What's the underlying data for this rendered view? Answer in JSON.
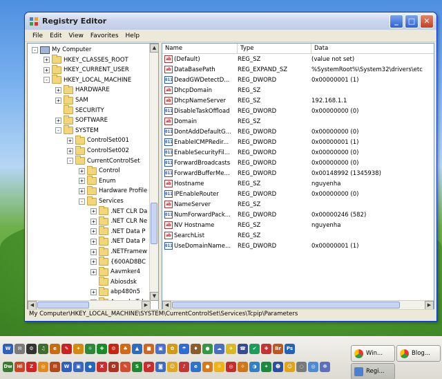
{
  "window": {
    "title": "Registry Editor",
    "buttons": {
      "minimize": "_",
      "maximize": "□",
      "close": "✕"
    }
  },
  "menu": [
    "File",
    "Edit",
    "View",
    "Favorites",
    "Help"
  ],
  "tree": [
    {
      "label": "My Computer",
      "depth": 0,
      "expander": "-",
      "icon": "computer"
    },
    {
      "label": "HKEY_CLASSES_ROOT",
      "depth": 1,
      "expander": "+",
      "icon": "folder"
    },
    {
      "label": "HKEY_CURRENT_USER",
      "depth": 1,
      "expander": "+",
      "icon": "folder"
    },
    {
      "label": "HKEY_LOCAL_MACHINE",
      "depth": 1,
      "expander": "-",
      "icon": "folder"
    },
    {
      "label": "HARDWARE",
      "depth": 2,
      "expander": "+",
      "icon": "folder"
    },
    {
      "label": "SAM",
      "depth": 2,
      "expander": "+",
      "icon": "folder"
    },
    {
      "label": "SECURITY",
      "depth": 2,
      "expander": "",
      "icon": "folder"
    },
    {
      "label": "SOFTWARE",
      "depth": 2,
      "expander": "+",
      "icon": "folder"
    },
    {
      "label": "SYSTEM",
      "depth": 2,
      "expander": "-",
      "icon": "folder"
    },
    {
      "label": "ControlSet001",
      "depth": 3,
      "expander": "+",
      "icon": "folder"
    },
    {
      "label": "ControlSet002",
      "depth": 3,
      "expander": "+",
      "icon": "folder"
    },
    {
      "label": "CurrentControlSet",
      "depth": 3,
      "expander": "-",
      "icon": "folder"
    },
    {
      "label": "Control",
      "depth": 4,
      "expander": "+",
      "icon": "folder"
    },
    {
      "label": "Enum",
      "depth": 4,
      "expander": "+",
      "icon": "folder"
    },
    {
      "label": "Hardware Profile",
      "depth": 4,
      "expander": "+",
      "icon": "folder"
    },
    {
      "label": "Services",
      "depth": 4,
      "expander": "-",
      "icon": "folder"
    },
    {
      "label": ".NET CLR Da",
      "depth": 5,
      "expander": "+",
      "icon": "folder"
    },
    {
      "label": ".NET CLR Ne",
      "depth": 5,
      "expander": "+",
      "icon": "folder"
    },
    {
      "label": ".NET Data P",
      "depth": 5,
      "expander": "+",
      "icon": "folder"
    },
    {
      "label": ".NET Data P",
      "depth": 5,
      "expander": "+",
      "icon": "folder"
    },
    {
      "label": ".NETFramew",
      "depth": 5,
      "expander": "+",
      "icon": "folder"
    },
    {
      "label": "{600AD8BC",
      "depth": 5,
      "expander": "+",
      "icon": "folder"
    },
    {
      "label": "Aavmker4",
      "depth": 5,
      "expander": "+",
      "icon": "folder"
    },
    {
      "label": "Abiosdsk",
      "depth": 5,
      "expander": "",
      "icon": "folder"
    },
    {
      "label": "abp480n5",
      "depth": 5,
      "expander": "+",
      "icon": "folder"
    },
    {
      "label": "Acapela Tele",
      "depth": 5,
      "expander": "+",
      "icon": "folder"
    }
  ],
  "list": {
    "headers": {
      "name": "Name",
      "type": "Type",
      "data": "Data"
    },
    "rows": [
      {
        "icon": "ab",
        "name": "(Default)",
        "type": "REG_SZ",
        "data": "(value not set)"
      },
      {
        "icon": "ab",
        "name": "DataBasePath",
        "type": "REG_EXPAND_SZ",
        "data": "%SystemRoot%\\System32\\drivers\\etc"
      },
      {
        "icon": "dword",
        "name": "DeadGWDetectD...",
        "type": "REG_DWORD",
        "data": "0x00000001 (1)"
      },
      {
        "icon": "ab",
        "name": "DhcpDomain",
        "type": "REG_SZ",
        "data": ""
      },
      {
        "icon": "ab",
        "name": "DhcpNameServer",
        "type": "REG_SZ",
        "data": "192.168.1.1"
      },
      {
        "icon": "dword",
        "name": "DisableTaskOffload",
        "type": "REG_DWORD",
        "data": "0x00000000 (0)"
      },
      {
        "icon": "ab",
        "name": "Domain",
        "type": "REG_SZ",
        "data": ""
      },
      {
        "icon": "dword",
        "name": "DontAddDefaultG...",
        "type": "REG_DWORD",
        "data": "0x00000000 (0)"
      },
      {
        "icon": "dword",
        "name": "EnableICMPRedir...",
        "type": "REG_DWORD",
        "data": "0x00000001 (1)"
      },
      {
        "icon": "dword",
        "name": "EnableSecurityFil...",
        "type": "REG_DWORD",
        "data": "0x00000000 (0)"
      },
      {
        "icon": "dword",
        "name": "ForwardBroadcasts",
        "type": "REG_DWORD",
        "data": "0x00000000 (0)"
      },
      {
        "icon": "dword",
        "name": "ForwardBufferMe...",
        "type": "REG_DWORD",
        "data": "0x00148992 (1345938)"
      },
      {
        "icon": "ab",
        "name": "Hostname",
        "type": "REG_SZ",
        "data": "nguyenha"
      },
      {
        "icon": "dword",
        "name": "IPEnableRouter",
        "type": "REG_DWORD",
        "data": "0x00000000 (0)"
      },
      {
        "icon": "ab",
        "name": "NameServer",
        "type": "REG_SZ",
        "data": ""
      },
      {
        "icon": "dword",
        "name": "NumForwardPack...",
        "type": "REG_DWORD",
        "data": "0x00000246 (582)"
      },
      {
        "icon": "ab",
        "name": "NV Hostname",
        "type": "REG_SZ",
        "data": "nguyenha"
      },
      {
        "icon": "ab",
        "name": "SearchList",
        "type": "REG_SZ",
        "data": ""
      },
      {
        "icon": "dword",
        "name": "UseDomainName...",
        "type": "REG_DWORD",
        "data": "0x00000001 (1)"
      }
    ]
  },
  "status": "My Computer\\HKEY_LOCAL_MACHINE\\SYSTEM\\CurrentControlSet\\Services\\Tcpip\\Parameters",
  "taskbar": {
    "buttons": [
      {
        "label": "Win...",
        "icon": "chrome"
      },
      {
        "label": "Blog...",
        "icon": "chrome"
      },
      {
        "label": "Regi...",
        "icon": "regedit",
        "active": true
      }
    ],
    "quicklaunch_top": [
      "W",
      "✉",
      "⚙",
      "♫",
      "e",
      "✎",
      "✦",
      "☼",
      "✚",
      "⚙",
      "♣",
      "▲",
      "■",
      "▣",
      "✿",
      "☂",
      "♦",
      "●",
      "☁",
      "✈",
      "☎",
      "✔",
      "✚",
      "Br",
      "Ps"
    ],
    "quicklaunch_bottom": [
      "Dw",
      "Hi",
      "Z",
      "◎",
      "✉",
      "W",
      "▣",
      "◆",
      "X",
      "O",
      "✎",
      "S",
      "P",
      "◙",
      "☺",
      "♪",
      "e",
      "●",
      "☼",
      "◎",
      "☼",
      "◑",
      "✦",
      "☻",
      "☺",
      "◌",
      "◎",
      "☸"
    ],
    "colors_top": [
      "#2f5fbf",
      "#7a7a7a",
      "#333",
      "#3b6f2e",
      "#c96c12",
      "#c22",
      "#d48a12",
      "#2a8a3a",
      "#1a8a2a",
      "#c21",
      "#d26914",
      "#2c6dc4",
      "#c62",
      "#4b70c9",
      "#cf9b17",
      "#2e6bd6",
      "#8a5c2d",
      "#2f9a3f",
      "#4c6fc2",
      "#d9b820",
      "#374d8f",
      "#1b9d5c",
      "#c23333",
      "#c0561e",
      "#2563b8"
    ],
    "colors_bottom": [
      "#3a7c2e",
      "#cc4422",
      "#d42323",
      "#e08a17",
      "#b5471c",
      "#2f5fbf",
      "#3866c2",
      "#2367c5",
      "#cc2d2d",
      "#b2311e",
      "#d24d2e",
      "#1e8a2f",
      "#cf2b2b",
      "#3b6ac8",
      "#e1a91a",
      "#c23636",
      "#2c73cf",
      "#db7a12",
      "#f0b317",
      "#c42c2c",
      "#d17716",
      "#2e80c8",
      "#1b8a3e",
      "#2b4fa6",
      "#e3a412",
      "#7a7a7a",
      "#4d8bd6",
      "#5a6fbe"
    ]
  }
}
